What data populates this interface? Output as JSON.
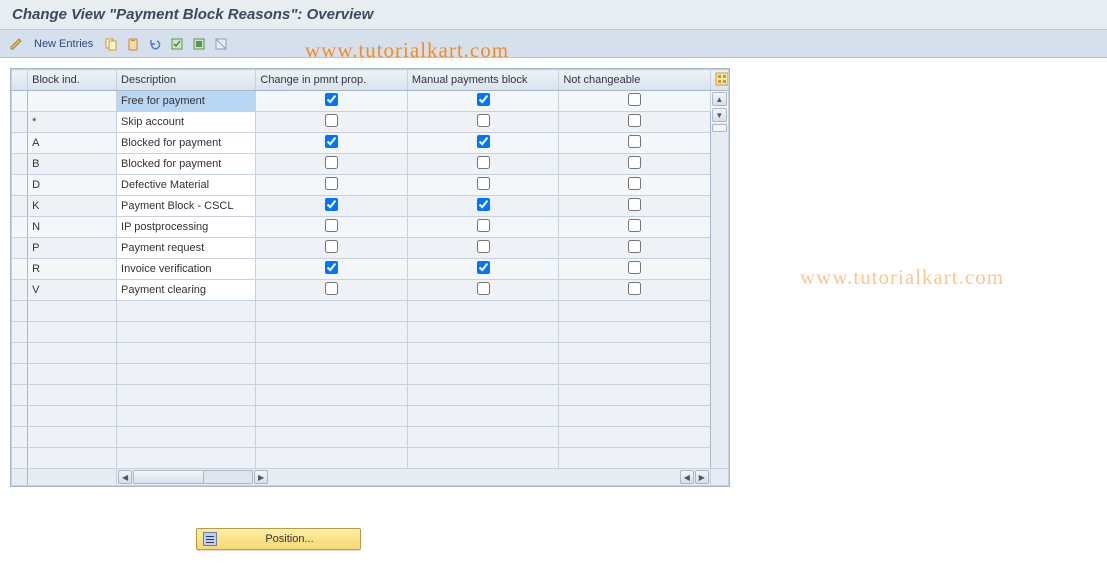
{
  "title": "Change View \"Payment Block Reasons\": Overview",
  "toolbar": {
    "change_display_tooltip": "Change <-> Display",
    "new_entries": "New Entries",
    "icons": [
      "doc-copy",
      "clipboard",
      "undo",
      "save-variant",
      "export",
      "table-settings"
    ]
  },
  "watermark": "www.tutorialkart.com",
  "table": {
    "columns": {
      "block_ind": "Block ind.",
      "description": "Description",
      "change_pmnt": "Change in pmnt prop.",
      "manual_block": "Manual payments block",
      "not_changeable": "Not changeable"
    },
    "rows": [
      {
        "ind": "",
        "desc": "Free for payment",
        "chg": true,
        "man": true,
        "nc": false,
        "sel": true
      },
      {
        "ind": "*",
        "desc": "Skip account",
        "chg": false,
        "man": false,
        "nc": false
      },
      {
        "ind": "A",
        "desc": "Blocked for payment",
        "chg": true,
        "man": true,
        "nc": false
      },
      {
        "ind": "B",
        "desc": "Blocked for payment",
        "chg": false,
        "man": false,
        "nc": false
      },
      {
        "ind": "D",
        "desc": "Defective Material",
        "chg": false,
        "man": false,
        "nc": false
      },
      {
        "ind": "K",
        "desc": "Payment Block - CSCL",
        "chg": true,
        "man": true,
        "nc": false
      },
      {
        "ind": "N",
        "desc": "IP postprocessing",
        "chg": false,
        "man": false,
        "nc": false
      },
      {
        "ind": "P",
        "desc": "Payment request",
        "chg": false,
        "man": false,
        "nc": false
      },
      {
        "ind": "R",
        "desc": "Invoice verification",
        "chg": true,
        "man": true,
        "nc": false
      },
      {
        "ind": "V",
        "desc": "Payment clearing",
        "chg": false,
        "man": false,
        "nc": false
      }
    ],
    "empty_rows": 8
  },
  "position_button": {
    "label": "Position..."
  }
}
